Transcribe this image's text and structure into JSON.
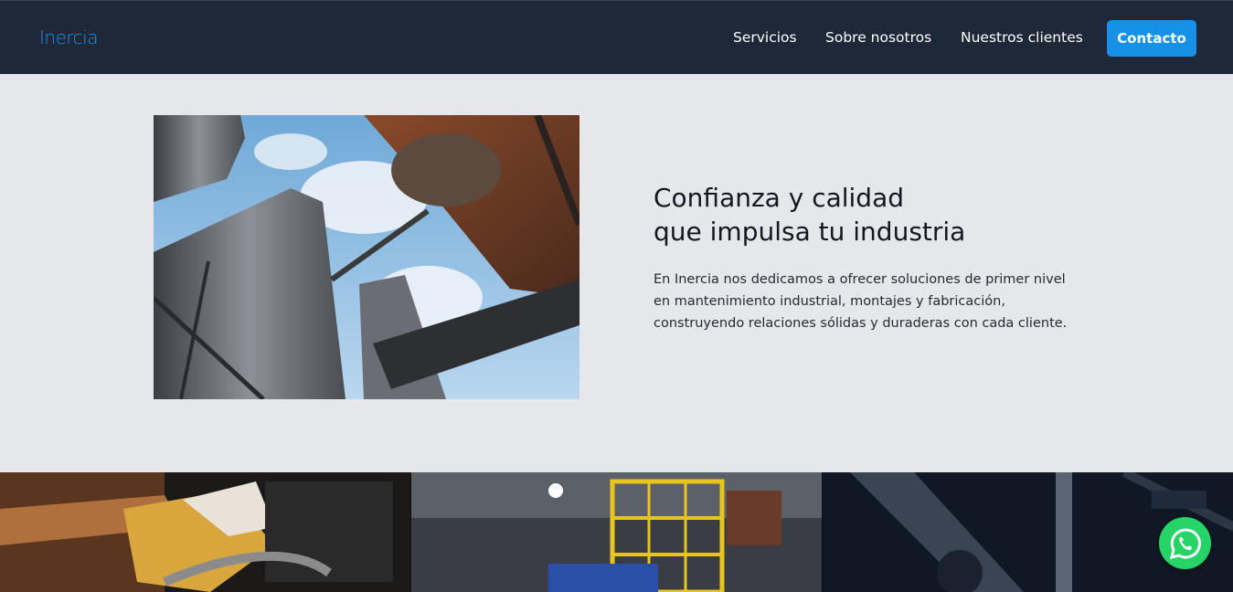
{
  "header": {
    "logo_text": "Inercia",
    "nav": [
      {
        "label": "Servicios"
      },
      {
        "label": "Sobre nosotros"
      },
      {
        "label": "Nuestros clientes"
      }
    ],
    "cta_label": "Contacto"
  },
  "hero": {
    "title_line1": "Confianza y calidad",
    "title_line2": "que impulsa tu industria",
    "body": "En Inercia nos dedicamos a ofrecer soluciones de primer nivel en mantenimiento industrial, montajes y fabricación, construyendo relaciones sólidas y duraderas con cada cliente.",
    "image_icon": "industrial-silos-photo"
  },
  "gallery": {
    "tiles": [
      {
        "icon": "gloved-hands-welding-photo"
      },
      {
        "icon": "yellow-platform-structure-photo"
      },
      {
        "icon": "steel-structure-worker-photo"
      }
    ]
  },
  "floating": {
    "icon": "whatsapp-icon"
  },
  "colors": {
    "navbar": "#1f2839",
    "accent": "#1592e8",
    "page_bg": "#e6e7ea",
    "whatsapp": "#25d366"
  }
}
